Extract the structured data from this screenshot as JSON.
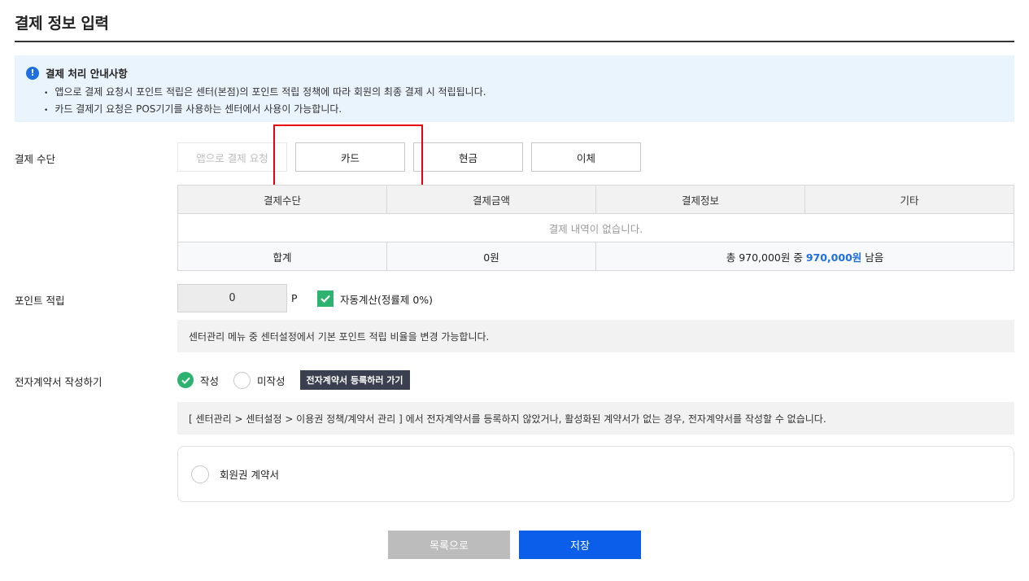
{
  "page": {
    "title": "결제 정보 입력"
  },
  "notice": {
    "icon_text": "!",
    "title": "결제 처리 안내사항",
    "items": [
      "앱으로 결제 요청시 포인트 적립은 센터(본점)의 포인트 적립 정책에 따라 회원의 최종 결제 시 적립됩니다.",
      "카드 결제기 요청은 POS기기를 사용하는 센터에서 사용이 가능합니다."
    ]
  },
  "payment": {
    "label": "결제 수단",
    "methods": [
      "앱으로 결제 요청",
      "카드",
      "현금",
      "이체"
    ],
    "table": {
      "headers": [
        "결제수단",
        "결제금액",
        "결제정보",
        "기타"
      ],
      "empty_text": "결제 내역이 없습니다.",
      "total_label": "합계",
      "total_amount": "0원",
      "remain_prefix": "총 970,000원 중 ",
      "remain_amount": "970,000원",
      "remain_suffix": " 남음"
    }
  },
  "points": {
    "label": "포인트 적립",
    "value": "0",
    "unit": "P",
    "auto_calc_label": "자동계산(정률제 0%)",
    "info": "센터관리 메뉴 중 센터설정에서 기본 포인트 적립 비율을 변경 가능합니다."
  },
  "contract": {
    "label": "전자계약서 작성하기",
    "option_write": "작성",
    "option_no_write": "미작성",
    "goto_button": "전자계약서 등록하러 가기",
    "info": "[ 센터관리 > 센터설정 > 이용권 정책/계약서 관리 ] 에서 전자계약서를 등록하지 않았거나, 활성화된 계약서가 없는 경우, 전자계약서를 작성할 수 없습니다.",
    "item_label": "회원권 계약서"
  },
  "actions": {
    "list_label": "목록으로",
    "save_label": "저장"
  },
  "colors": {
    "accent": "#0b5ee9",
    "check": "#2db36f",
    "highlight": "#e60012"
  }
}
